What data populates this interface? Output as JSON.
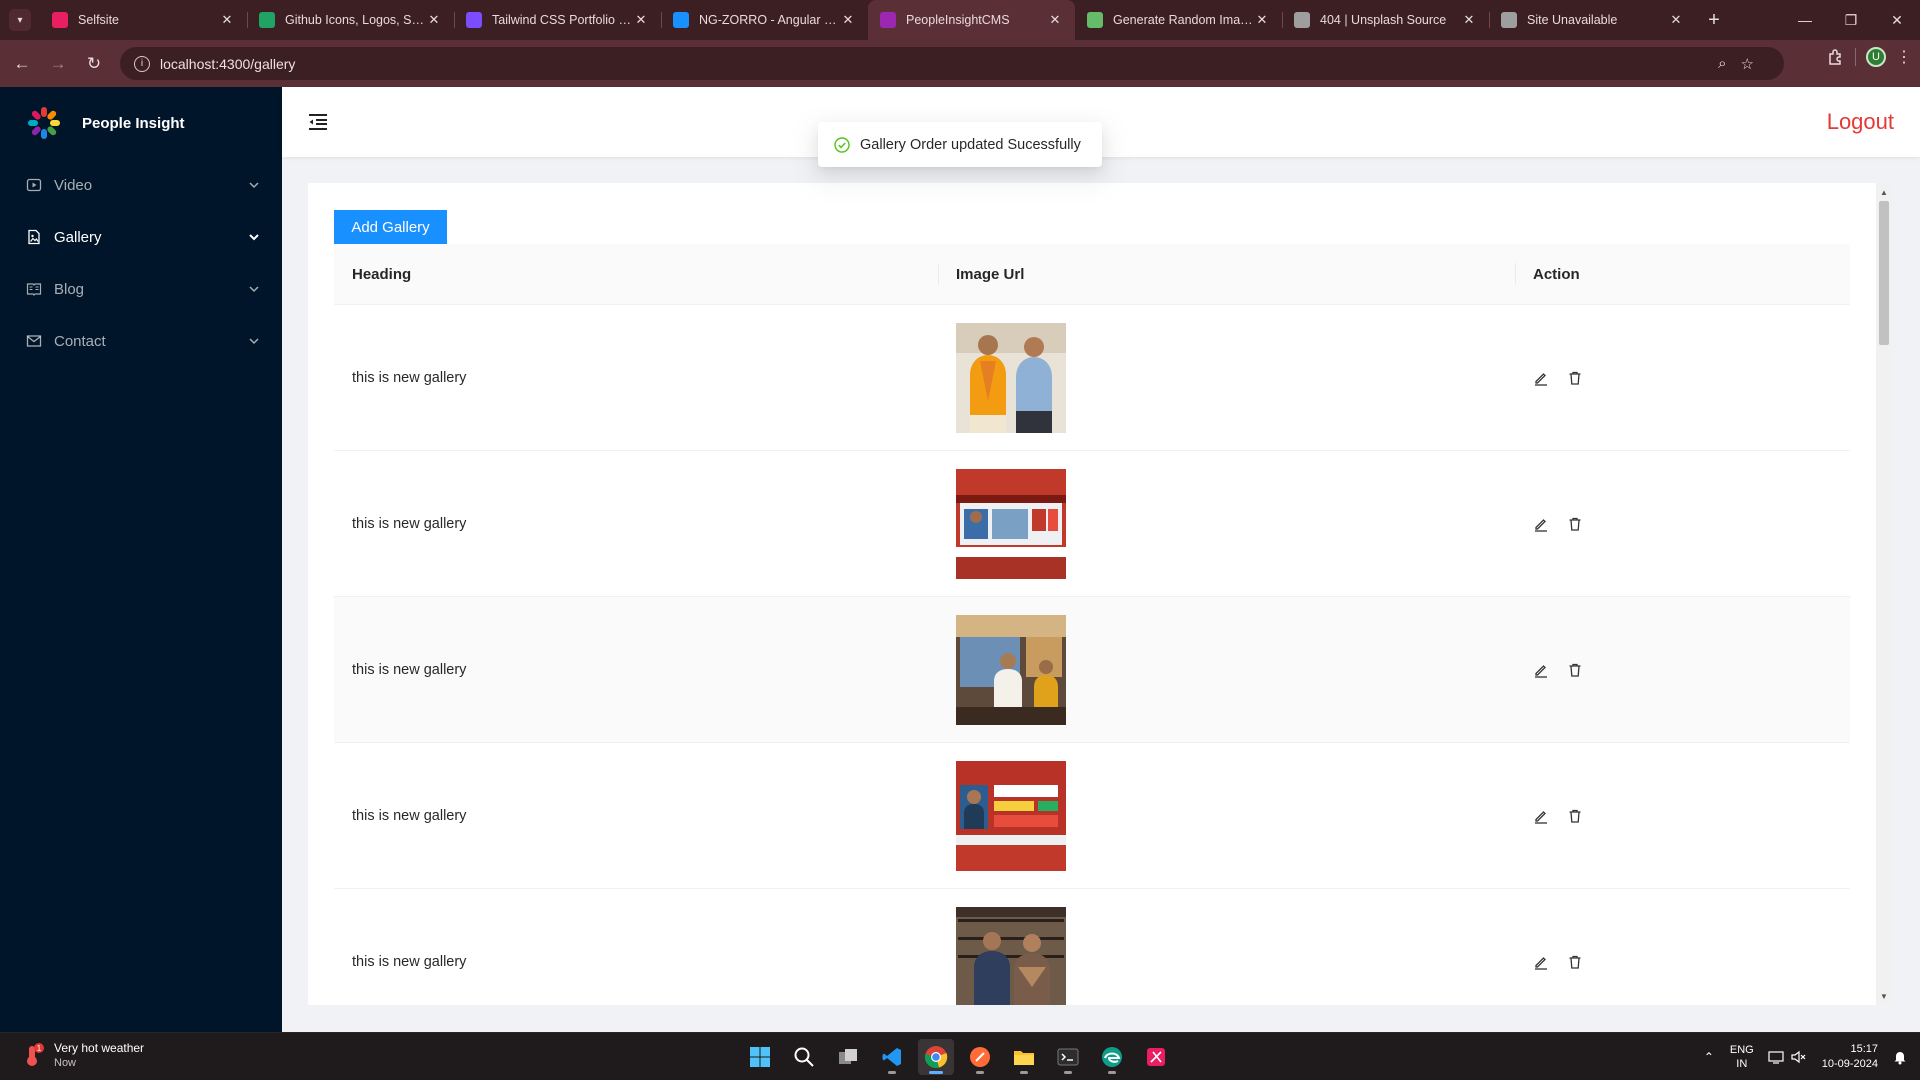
{
  "browser": {
    "tabs": [
      {
        "title": "Selfsite",
        "favicon_color": "#e91e63"
      },
      {
        "title": "Github Icons, Logos, Symbols",
        "favicon_color": "#21a366"
      },
      {
        "title": "Tailwind CSS Portfolio Section",
        "favicon_color": "#7c4dff"
      },
      {
        "title": "NG-ZORRO - Angular UI component library",
        "favicon_color": "#1890ff"
      },
      {
        "title": "PeopleInsightCMS",
        "favicon_color": "#9c27b0"
      },
      {
        "title": "Generate Random Images",
        "favicon_color": "#66bb6a"
      },
      {
        "title": "404 | Unsplash Source",
        "favicon_color": "#9e9e9e"
      },
      {
        "title": "Site Unavailable",
        "favicon_color": "#9e9e9e"
      }
    ],
    "active_tab_index": 4,
    "url": "localhost:4300/gallery",
    "profile_initial": "U"
  },
  "sidebar": {
    "brand": "People Insight",
    "items": [
      {
        "label": "Video",
        "icon": "play-square-icon",
        "open": false
      },
      {
        "label": "Gallery",
        "icon": "file-image-icon",
        "open": true
      },
      {
        "label": "Blog",
        "icon": "read-icon",
        "open": false
      },
      {
        "label": "Contact",
        "icon": "mail-icon",
        "open": false
      }
    ]
  },
  "header": {
    "logout_label": "Logout"
  },
  "toast": {
    "message": "Gallery Order updated Sucessfully"
  },
  "gallery": {
    "add_button_label": "Add Gallery",
    "columns": [
      "Heading",
      "Image Url",
      "Action"
    ],
    "rows": [
      {
        "heading": "this is new gallery",
        "image": "two men posing, one in orange scarf"
      },
      {
        "heading": "this is new gallery",
        "image": "news channel screenshot with red banner"
      },
      {
        "heading": "this is new gallery",
        "image": "men standing at event with screen behind"
      },
      {
        "heading": "this is new gallery",
        "image": "news broadcast screenshot red layout"
      },
      {
        "heading": "this is new gallery",
        "image": "man and woman in front of bookshelves"
      }
    ],
    "highlighted_row_index": 2
  },
  "taskbar": {
    "weather_title": "Very hot weather",
    "weather_sub": "Now",
    "weather_badge": "1",
    "lang_line1": "ENG",
    "lang_line2": "IN",
    "time": "15:17",
    "date": "10-09-2024"
  },
  "colors": {
    "sidebar_bg": "#001529",
    "primary": "#1890ff",
    "logout": "#e53935",
    "success": "#52c41a"
  }
}
